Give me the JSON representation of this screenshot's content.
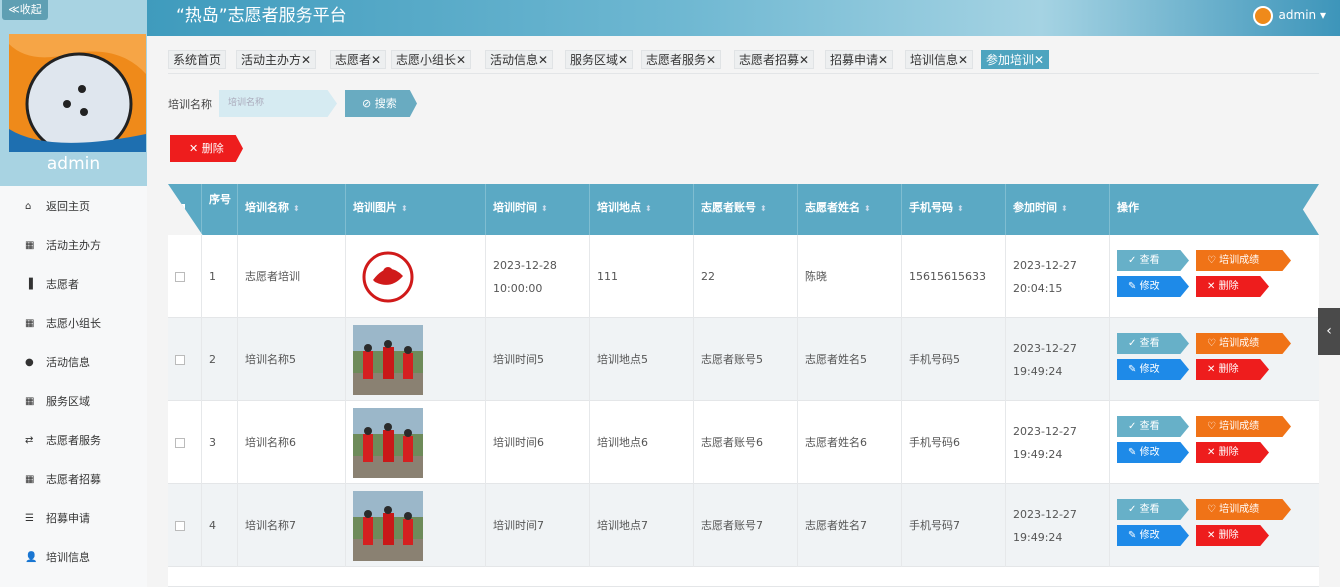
{
  "sidebar": {
    "collapse_label": "≪收起",
    "username": "admin",
    "menu": [
      {
        "icon": "home-icon",
        "glyph": "⌂",
        "label": "返回主页"
      },
      {
        "icon": "grid-icon",
        "glyph": "▦",
        "label": "活动主办方"
      },
      {
        "icon": "bars-icon",
        "glyph": "▐",
        "label": "志愿者"
      },
      {
        "icon": "grid-icon",
        "glyph": "▦",
        "label": "志愿小组长"
      },
      {
        "icon": "pin-icon",
        "glyph": "●",
        "label": "活动信息"
      },
      {
        "icon": "grid-icon",
        "glyph": "▦",
        "label": "服务区域"
      },
      {
        "icon": "exchange-icon",
        "glyph": "⇄",
        "label": "志愿者服务"
      },
      {
        "icon": "grid-icon",
        "glyph": "▦",
        "label": "志愿者招募"
      },
      {
        "icon": "list-icon",
        "glyph": "☰",
        "label": "招募申请"
      },
      {
        "icon": "user-icon",
        "glyph": "👤",
        "label": "培训信息"
      }
    ]
  },
  "header": {
    "title": "“热岛”志愿者服务平台",
    "user": "admin",
    "caret": "▾"
  },
  "tabs": [
    "系统首页",
    "活动主办方",
    "志愿者",
    "志愿小组长",
    "活动信息",
    "服务区域",
    "志愿者服务",
    "志愿者招募",
    "招募申请",
    "培训信息",
    "参加培训"
  ],
  "tab_close": "✕",
  "search": {
    "label": "培训名称",
    "placeholder": "培训名称",
    "button": "搜索",
    "button_icon": "⊘"
  },
  "delete_button": "删除",
  "delete_icon": "✕",
  "table": {
    "headers": [
      "序号",
      "培训名称",
      "培训图片",
      "培训时间",
      "培训地点",
      "志愿者账号",
      "志愿者姓名",
      "手机号码",
      "参加时间",
      "操作"
    ],
    "sortable": [
      false,
      true,
      true,
      true,
      true,
      true,
      true,
      true,
      true,
      false
    ],
    "rows": [
      {
        "no": "1",
        "name": "志愿者培训",
        "image": "logo",
        "time": "2023-12-28 10:00:00",
        "place": "111",
        "account": "22",
        "vname": "陈晓",
        "phone": "15615615633",
        "joined": "2023-12-27 20:04:15"
      },
      {
        "no": "2",
        "name": "培训名称5",
        "image": "photo",
        "time": "培训时间5",
        "place": "培训地点5",
        "account": "志愿者账号5",
        "vname": "志愿者姓名5",
        "phone": "手机号码5",
        "joined": "2023-12-27 19:49:24"
      },
      {
        "no": "3",
        "name": "培训名称6",
        "image": "photo",
        "time": "培训时间6",
        "place": "培训地点6",
        "account": "志愿者账号6",
        "vname": "志愿者姓名6",
        "phone": "手机号码6",
        "joined": "2023-12-27 19:49:24"
      },
      {
        "no": "4",
        "name": "培训名称7",
        "image": "photo",
        "time": "培训时间7",
        "place": "培训地点7",
        "account": "志愿者账号7",
        "vname": "志愿者姓名7",
        "phone": "手机号码7",
        "joined": "2023-12-27 19:49:24"
      }
    ],
    "actions": {
      "view": "查看",
      "score": "培训成绩",
      "edit": "修改",
      "delete": "删除",
      "view_icon": "✓",
      "score_icon": "♡",
      "edit_icon": "✎",
      "delete_icon": "✕"
    }
  },
  "side_toggle": "‹"
}
